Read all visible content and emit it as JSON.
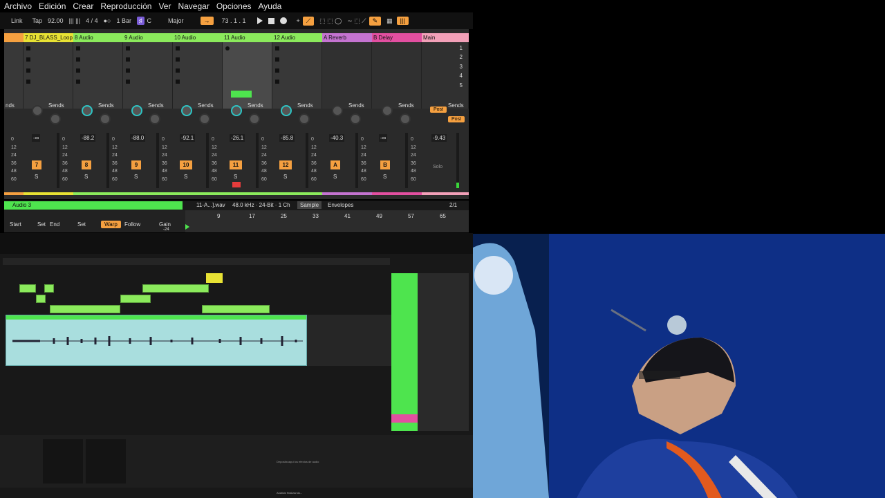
{
  "menu": [
    "Archivo",
    "Edición",
    "Crear",
    "Reproducción",
    "Ver",
    "Navegar",
    "Opciones",
    "Ayuda"
  ],
  "transport": {
    "link": "Link",
    "tap": "Tap",
    "tempo": "92.00",
    "signature": "4 / 4",
    "quant": "1 Bar",
    "key": "C",
    "scale": "Major",
    "position": "73 .  1 .  1"
  },
  "tracks": [
    {
      "name": "",
      "color": "#f5a040"
    },
    {
      "name": "7 DJ_BLASS_Loop",
      "color": "#e8e234"
    },
    {
      "name": "8 Audio",
      "color": "#8bea5c"
    },
    {
      "name": "9 Audio",
      "color": "#8bea5c"
    },
    {
      "name": "10 Audio",
      "color": "#8bea5c"
    },
    {
      "name": "11 Audio",
      "color": "#8bea5c"
    },
    {
      "name": "12 Audio",
      "color": "#8bea5c"
    },
    {
      "name": "A Reverb",
      "color": "#c473d0"
    },
    {
      "name": "B Delay",
      "color": "#e24fa0"
    },
    {
      "name": "Main",
      "color": "#f2a0b8"
    }
  ],
  "scenes": [
    "1",
    "2",
    "3",
    "4",
    "5"
  ],
  "sends_label": "Sends",
  "send_a": "A",
  "send_b": "B",
  "volumes": [
    "-∞",
    "-88.2",
    "-88.0",
    "-92.1",
    "-26.1",
    "-85.8",
    "-40.3",
    "-∞",
    "-9.43"
  ],
  "track_numbers": [
    "7",
    "8",
    "9",
    "10",
    "11",
    "12",
    "A",
    "B"
  ],
  "meter_scale": [
    "0",
    "12",
    "24",
    "36",
    "48",
    "60"
  ],
  "solo": "S",
  "post": "Post",
  "solo_main": "Solo",
  "clip": {
    "name": "Audio 3",
    "file": "11-A...].wav",
    "format": "48.0 kHz · 24-Bit · 1 Ch",
    "sample_tab": "Sample",
    "envelopes_tab": "Envelopes",
    "zoom": "2/1"
  },
  "clip_controls": {
    "start": "Start",
    "set1": "Set",
    "end": "End",
    "set2": "Set",
    "warp": "Warp",
    "follow": "Follow",
    "gain": "Gain",
    "gain_val": "-24"
  },
  "ruler": [
    "9",
    "17",
    "25",
    "33",
    "41",
    "49",
    "57",
    "65"
  ],
  "lower": {
    "device_hint": "Deposita aquí los efectos de audio",
    "status": "Análisis finalizando..."
  }
}
